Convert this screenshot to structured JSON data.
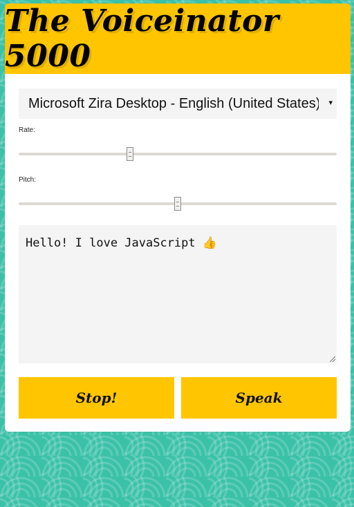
{
  "app": {
    "title": "The Voiceinator 5000"
  },
  "voice_select": {
    "selected": "Microsoft Zira Desktop - English (United States)",
    "arrow": "▾"
  },
  "rate": {
    "label": "Rate:",
    "value_fraction": 0.35
  },
  "pitch": {
    "label": "Pitch:",
    "value_fraction": 0.5
  },
  "message": {
    "text": "Hello! I love JavaScript ",
    "emoji": "👍"
  },
  "buttons": {
    "stop_label": "Stop!",
    "speak_label": "Speak"
  },
  "colors": {
    "accent": "#ffc600",
    "background": "#3bc1a8"
  }
}
